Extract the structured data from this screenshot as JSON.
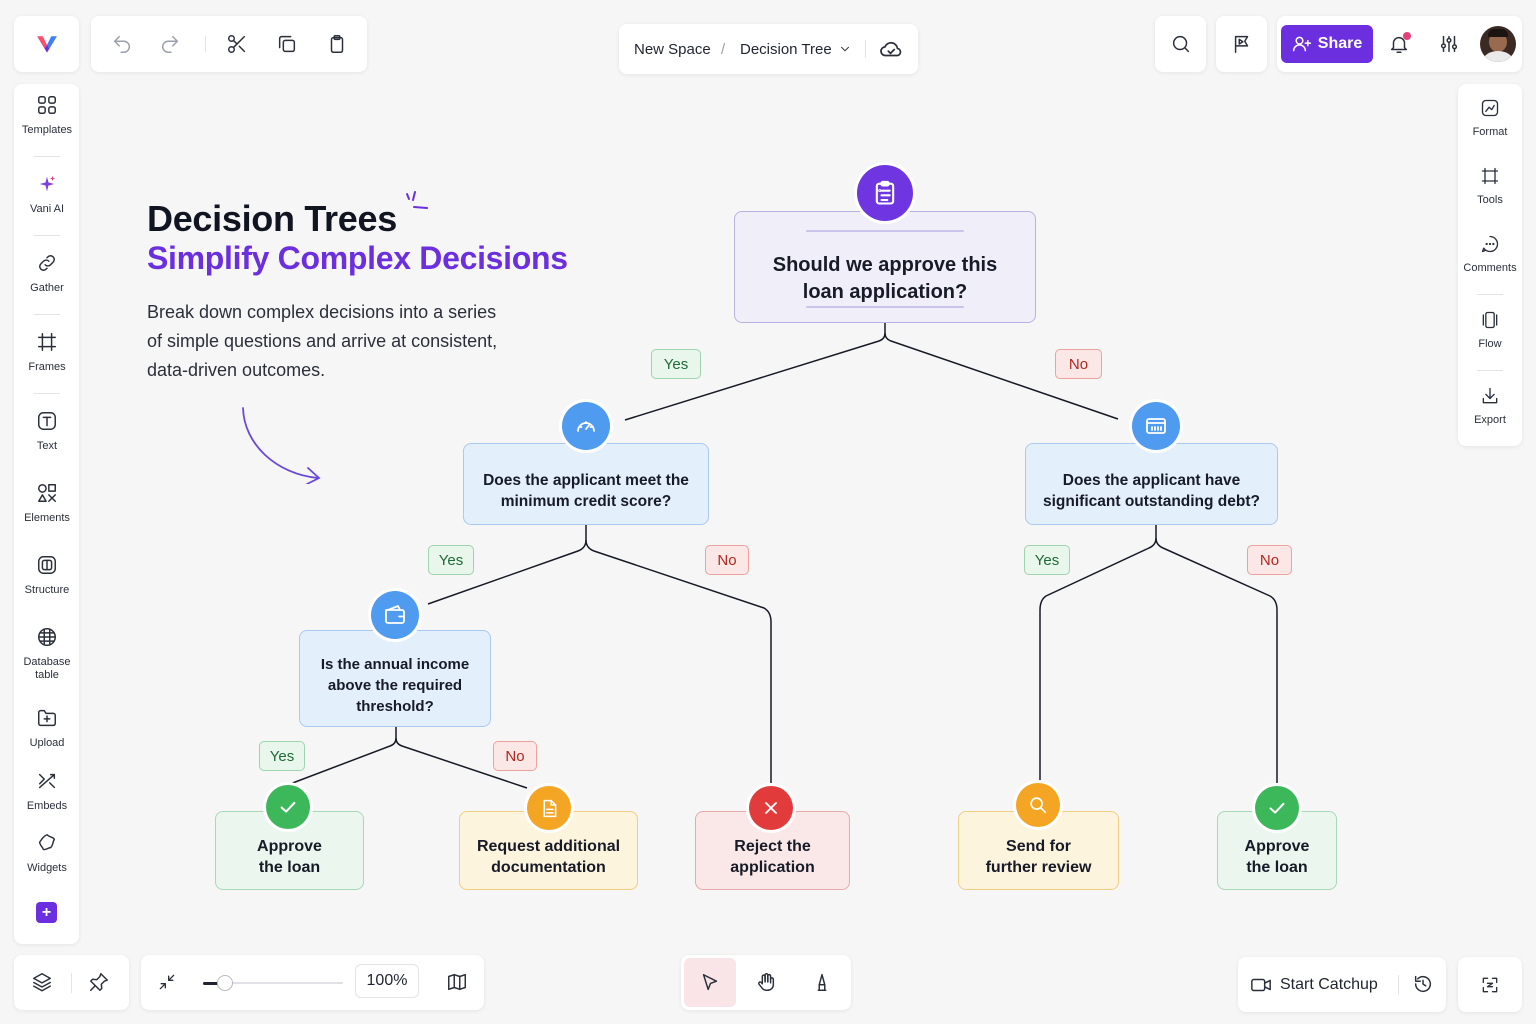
{
  "colors": {
    "accent": "#6b2fe0",
    "share_bg": "#6b2fe0",
    "yes_green": "#1f6b36",
    "no_red": "#b3261e",
    "badge_purple": "#6e35e0",
    "badge_blue": "#4f9bef",
    "badge_green": "#3cb75a",
    "badge_orange": "#f4a524",
    "badge_red": "#e23b3b"
  },
  "topbar": {
    "breadcrumb": {
      "space": "New Space",
      "separator": "/",
      "page": "Decision Tree"
    },
    "share_label": "Share",
    "icons": [
      "logo-icon",
      "undo-icon",
      "redo-icon",
      "scissors-icon",
      "copy-icon",
      "clipboard-icon",
      "chevron-down-icon",
      "cloud-check-icon",
      "search-icon",
      "flag-play-icon",
      "user-plus-icon",
      "bell-icon",
      "sliders-icon",
      "avatar"
    ]
  },
  "sidebar": {
    "items": [
      {
        "label": "Templates",
        "icon": "templates-icon"
      },
      {
        "label": "Vani AI",
        "icon": "sparkle-icon"
      },
      {
        "label": "Gather",
        "icon": "link-icon"
      },
      {
        "label": "Frames",
        "icon": "frame-icon"
      },
      {
        "label": "Text",
        "icon": "text-icon"
      },
      {
        "label": "Elements",
        "icon": "elements-icon"
      },
      {
        "label": "Structure",
        "icon": "structure-icon"
      },
      {
        "label": "Database table",
        "icon": "database-table-icon"
      },
      {
        "label": "Upload",
        "icon": "upload-icon"
      },
      {
        "label": "Embeds",
        "icon": "embeds-icon"
      },
      {
        "label": "Widgets",
        "icon": "widgets-icon"
      }
    ],
    "add_label": "+"
  },
  "right_sidebar": {
    "items": [
      {
        "label": "Format",
        "icon": "format-icon"
      },
      {
        "label": "Tools",
        "icon": "tools-icon"
      },
      {
        "label": "Comments",
        "icon": "comments-icon"
      },
      {
        "label": "Flow",
        "icon": "flow-icon"
      },
      {
        "label": "Export",
        "icon": "export-icon"
      }
    ]
  },
  "hero": {
    "title": "Decision Trees",
    "subtitle": "Simplify Complex Decisions",
    "description": "Break down complex decisions into a series of simple questions and arrive at consistent, data-driven outcomes."
  },
  "tree": {
    "root": {
      "text": "Should we approve this loan application?",
      "icon": "clipboard-list-icon"
    },
    "credit": {
      "text": "Does the applicant meet the minimum credit score?",
      "icon": "gauge-icon"
    },
    "debt": {
      "text": "Does the applicant have significant outstanding debt?",
      "icon": "debt-card-icon"
    },
    "income": {
      "text": "Is the annual income above the required threshold?",
      "icon": "wallet-icon"
    },
    "approve1": {
      "text": "Approve the loan",
      "icon": "check-icon"
    },
    "docs": {
      "text": "Request additional documentation",
      "icon": "document-icon"
    },
    "reject": {
      "text": "Reject the application",
      "icon": "x-icon"
    },
    "review": {
      "text": "Send for further review",
      "icon": "magnifier-icon"
    },
    "approve2": {
      "text": "Approve the loan",
      "icon": "check-icon"
    },
    "labels": {
      "yes": "Yes",
      "no": "No"
    }
  },
  "bottombar": {
    "zoom": "100%",
    "catchup_label": "Start Catchup",
    "icons": [
      "layers-icon",
      "pin-icon",
      "collapse-icon",
      "zoom-slider",
      "map-icon",
      "pointer-icon",
      "hand-icon",
      "pen-icon",
      "video-icon",
      "history-icon",
      "fit-screen-icon"
    ]
  }
}
